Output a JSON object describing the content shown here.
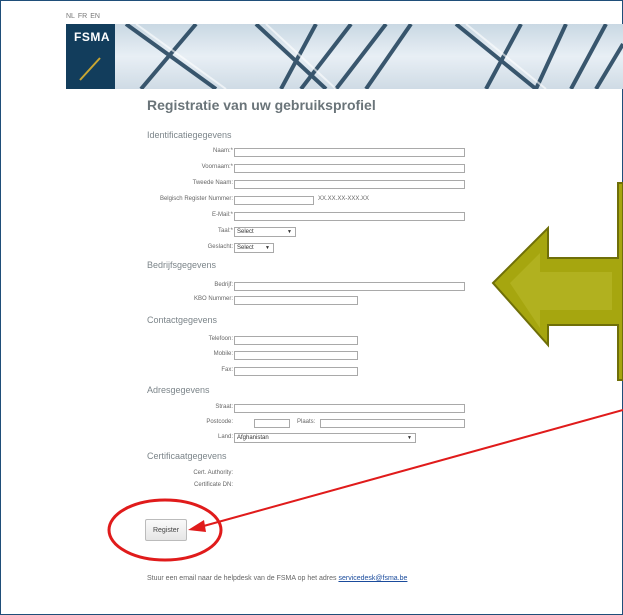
{
  "languages": [
    "NL",
    "FR",
    "EN"
  ],
  "logo": {
    "text": "FSMA"
  },
  "page_title": "Registratie van uw gebruiksprofiel",
  "sections": {
    "identification": "Identificatiegegevens",
    "company": "Bedrijfsgegevens",
    "contact": "Contactgegevens",
    "address": "Adresgegevens",
    "certificate": "Certificaatgegevens"
  },
  "fields": {
    "naam": {
      "label": "Naam:*",
      "value": ""
    },
    "voornaam": {
      "label": "Voornaam:*",
      "value": ""
    },
    "tweede_naam": {
      "label": "Tweede Naam:",
      "value": ""
    },
    "rijksregister": {
      "label": "Belgisch Register Nummer:",
      "value": "",
      "hint": "XX.XX.XX-XXX.XX"
    },
    "email": {
      "label": "E-Mail:*",
      "value": ""
    },
    "taal": {
      "label": "Taal:*",
      "selected": "Select"
    },
    "geslacht": {
      "label": "Geslacht:",
      "selected": "Select"
    },
    "bedrijf": {
      "label": "Bedrijf:",
      "value": ""
    },
    "kbo": {
      "label": "KBO Nummer:",
      "value": ""
    },
    "telefoon": {
      "label": "Telefoon:",
      "value": ""
    },
    "mobile": {
      "label": "Mobile:",
      "value": ""
    },
    "fax": {
      "label": "Fax:",
      "value": ""
    },
    "straat": {
      "label": "Straat:",
      "value": ""
    },
    "postcode": {
      "label": "Postcode:",
      "value": ""
    },
    "plaats": {
      "label": "Plaats:",
      "value": ""
    },
    "land": {
      "label": "Land:",
      "selected": "Afghanistan"
    },
    "cert_authority": {
      "label": "Cert. Authority:"
    },
    "certificate_dn": {
      "label": "Certificate DN:"
    }
  },
  "register_button": "Register",
  "footer": {
    "text": "Stuur een email naar de helpdesk van de FSMA op het adres",
    "link": "servicedesk@fsma.be"
  },
  "annotation_colors": {
    "arrow": "#a6a60f",
    "circle": "#e01b1b"
  },
  "icons": {
    "select_arrow": "triangle-down"
  }
}
